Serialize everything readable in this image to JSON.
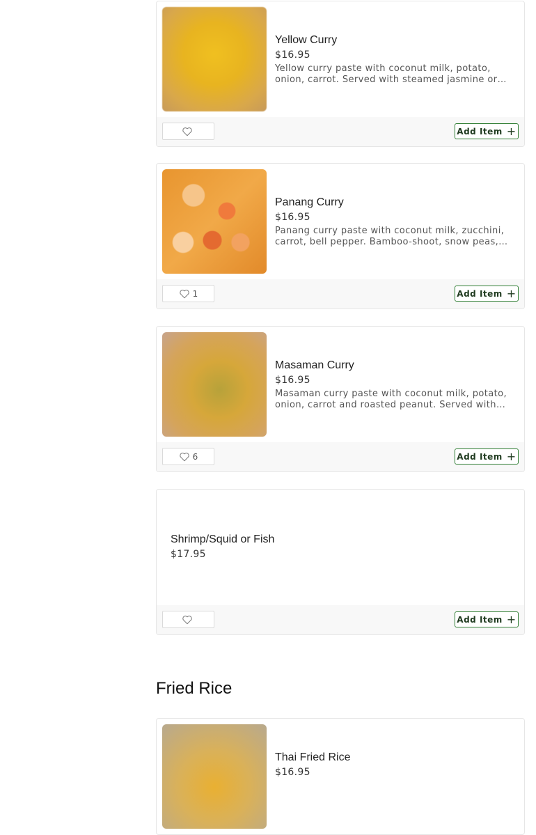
{
  "items": [
    {
      "name": "Yellow Curry",
      "price": "$16.95",
      "description": "Yellow curry paste with coconut milk, potato, onion, carrot. Served with steamed jasmine or rice.",
      "likes": "",
      "add_label": "Add Item"
    },
    {
      "name": "Panang Curry",
      "price": "$16.95",
      "description": "Panang curry paste with coconut milk, zucchini, carrot, bell pepper. Bamboo-shoot, snow peas, basil.",
      "likes": "1",
      "add_label": "Add Item"
    },
    {
      "name": "Masaman Curry",
      "price": "$16.95",
      "description": "Masaman curry paste with coconut milk, potato, onion, carrot and roasted peanut. Served with rice.",
      "likes": "6",
      "add_label": "Add Item"
    },
    {
      "name": "Shrimp/Squid or Fish",
      "price": "$17.95",
      "likes": "",
      "add_label": "Add Item"
    }
  ],
  "sections": [
    {
      "title": "Fried Rice"
    }
  ],
  "fried_rice_items": [
    {
      "name": "Thai Fried Rice",
      "price": "$16.95"
    }
  ],
  "icons": {
    "like": "heart-icon",
    "add": "plus-icon"
  },
  "colors": {
    "accent": "#2e7d32"
  }
}
